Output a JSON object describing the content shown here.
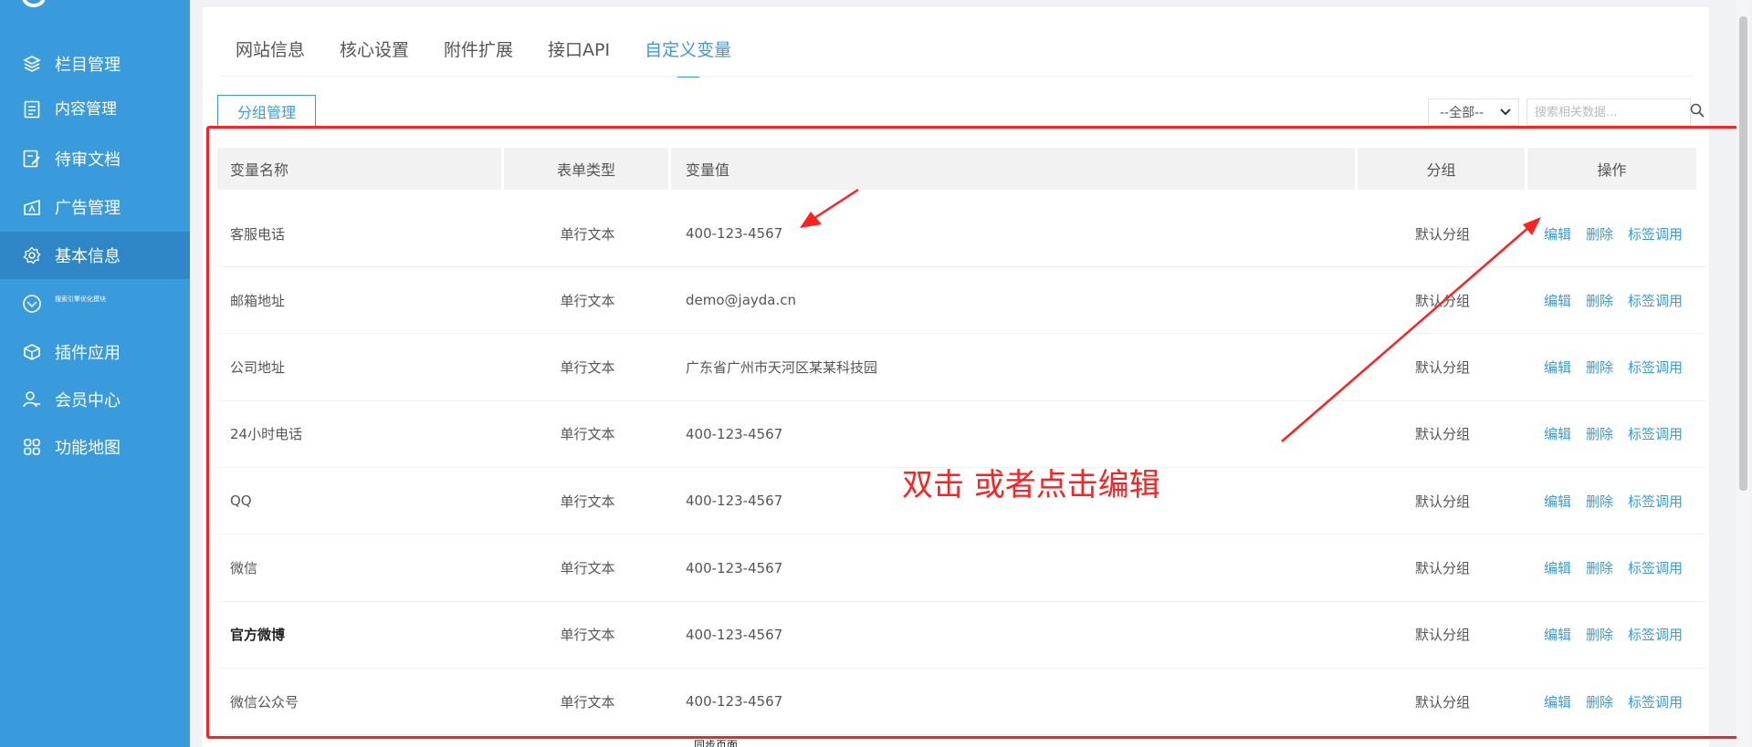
{
  "sidebar": {
    "items": [
      {
        "label": "栏目管理",
        "icon": "layers-icon"
      },
      {
        "label": "内容管理",
        "icon": "document-icon"
      },
      {
        "label": "待审文档",
        "icon": "edit-doc-icon"
      },
      {
        "label": "广告管理",
        "icon": "ad-icon"
      },
      {
        "label": "基本信息",
        "icon": "gear-icon",
        "active": true
      },
      {
        "label": "搜索引擎优化模块",
        "icon": "seo-icon"
      },
      {
        "label": "插件应用",
        "icon": "plugin-icon"
      },
      {
        "label": "会员中心",
        "icon": "user-icon"
      },
      {
        "label": "功能地图",
        "icon": "grid-icon"
      }
    ]
  },
  "tabs": [
    "网站信息",
    "核心设置",
    "附件扩展",
    "接口API",
    "自定义变量"
  ],
  "toolbar": {
    "group_button": "分组管理",
    "select_value": "--全部--",
    "search_placeholder": "搜索相关数据..."
  },
  "table": {
    "headers": [
      "变量名称",
      "表单类型",
      "变量值",
      "分组",
      "操作"
    ],
    "rows": [
      {
        "name": "客服电话",
        "type": "单行文本",
        "value": "400-123-4567",
        "group": "默认分组"
      },
      {
        "name": "邮箱地址",
        "type": "单行文本",
        "value": "demo@jayda.cn",
        "group": "默认分组"
      },
      {
        "name": "公司地址",
        "type": "单行文本",
        "value": "广东省广州市天河区某某科技园",
        "group": "默认分组"
      },
      {
        "name": "24小时电话",
        "type": "单行文本",
        "value": "400-123-4567",
        "group": "默认分组"
      },
      {
        "name": "QQ",
        "type": "单行文本",
        "value": "400-123-4567",
        "group": "默认分组"
      },
      {
        "name": "微信",
        "type": "单行文本",
        "value": "400-123-4567",
        "group": "默认分组"
      },
      {
        "name": "官方微博",
        "type": "单行文本",
        "value": "400-123-4567",
        "group": "默认分组"
      },
      {
        "name": "微信公众号",
        "type": "单行文本",
        "value": "400-123-4567",
        "group": "默认分组"
      }
    ],
    "actions": {
      "edit": "编辑",
      "delete": "删除",
      "tag": "标签调用"
    }
  },
  "annotation": {
    "text": "双击 或者点击编辑",
    "color": "#ff2020"
  },
  "bottom_fragment": "同步页面",
  "colors": {
    "sidebar": "#3a9bdc",
    "accent": "#3a9bdc",
    "annotation": "#ff2020"
  }
}
